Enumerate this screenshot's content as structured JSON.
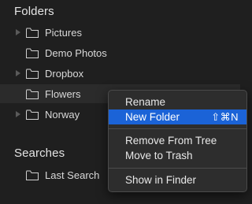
{
  "sections": {
    "folders_title": "Folders",
    "searches_title": "Searches"
  },
  "folders": [
    {
      "label": "Pictures",
      "has_children": true
    },
    {
      "label": "Demo Photos",
      "has_children": false
    },
    {
      "label": "Dropbox",
      "has_children": true
    },
    {
      "label": "Flowers",
      "has_children": false,
      "selected": true
    },
    {
      "label": "Norway",
      "has_children": true
    }
  ],
  "searches": [
    {
      "label": "Last Search"
    }
  ],
  "context_menu": {
    "rename": "Rename",
    "new_folder": "New Folder",
    "new_folder_shortcut": "⇧⌘N",
    "remove_from_tree": "Remove From Tree",
    "move_to_trash": "Move to Trash",
    "show_in_finder": "Show in Finder"
  },
  "colors": {
    "background": "#1f1f1f",
    "highlight": "#1b63d7",
    "menu_background": "#2d2d2d"
  }
}
